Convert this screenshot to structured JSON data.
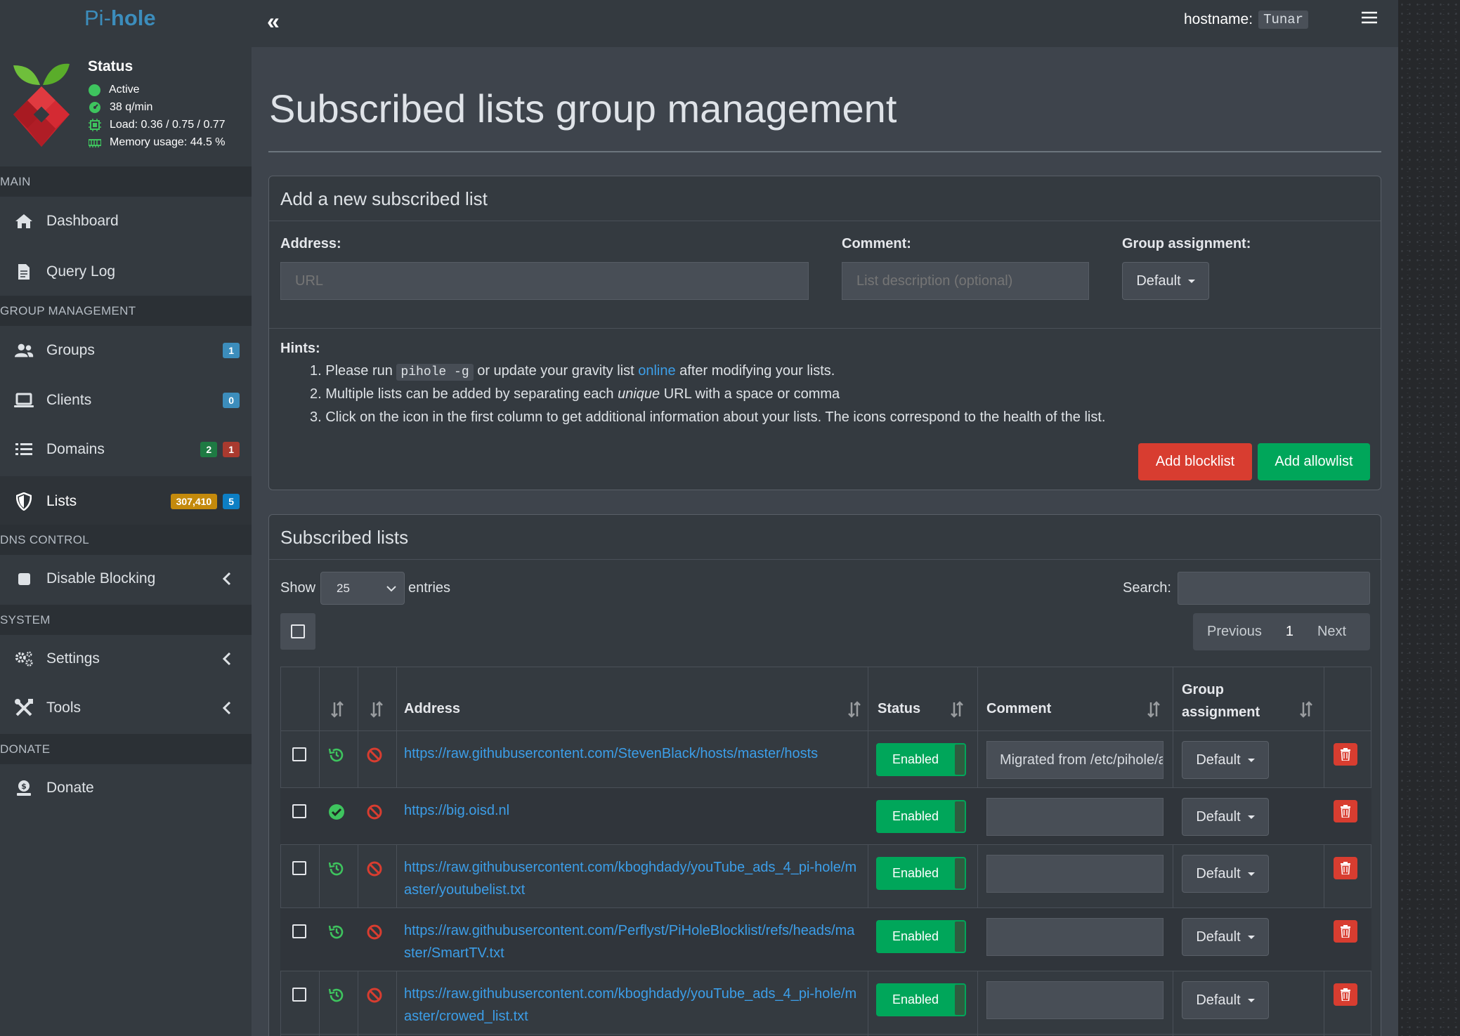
{
  "brand": {
    "prefix": "Pi-",
    "name": "hole"
  },
  "status": {
    "title": "Status",
    "active": "Active",
    "queries": "38 q/min",
    "load": "Load: 0.36 / 0.75 / 0.77",
    "memory": "Memory usage: 44.5 %"
  },
  "topbar": {
    "collapse": "«",
    "hostname_label": "hostname:",
    "hostname": "Tunar"
  },
  "sidebar": {
    "sections": {
      "main": "MAIN",
      "group": "GROUP MANAGEMENT",
      "dns": "DNS CONTROL",
      "system": "SYSTEM",
      "donate": "DONATE"
    },
    "items": {
      "dashboard": "Dashboard",
      "querylog": "Query Log",
      "groups": "Groups",
      "clients": "Clients",
      "domains": "Domains",
      "lists": "Lists",
      "disable": "Disable Blocking",
      "settings": "Settings",
      "tools": "Tools",
      "donate": "Donate"
    },
    "badges": {
      "groups": "1",
      "clients": "0",
      "domains_allow": "2",
      "domains_deny": "1",
      "lists_domains": "307,410",
      "lists_count": "5"
    }
  },
  "page": {
    "title": "Subscribed lists group management"
  },
  "addbox": {
    "title": "Add a new subscribed list",
    "address_label": "Address:",
    "address_placeholder": "URL",
    "comment_label": "Comment:",
    "comment_placeholder": "List description (optional)",
    "group_label": "Group assignment:",
    "group_value": "Default",
    "hints_title": "Hints:",
    "hint1_a": "1. Please run",
    "hint1_code": "pihole -g",
    "hint1_b": "or update your gravity list",
    "hint1_link": "online",
    "hint1_c": "after modifying your lists.",
    "hint2_a": "2. Multiple lists can be added by separating each",
    "hint2_em": "unique",
    "hint2_b": "URL with a space or comma",
    "hint3": "3. Click on the icon in the first column to get additional information about your lists. The icons correspond to the health of the list.",
    "add_blocklist": "Add blocklist",
    "add_allowlist": "Add allowlist"
  },
  "listbox": {
    "title": "Subscribed lists",
    "show": "Show",
    "entries_value": "25",
    "entries": "entries",
    "search_label": "Search:",
    "pager": {
      "prev": "Previous",
      "page": "1",
      "next": "Next"
    },
    "columns": {
      "address": "Address",
      "status": "Status",
      "comment": "Comment",
      "group1": "Group",
      "group2": "assignment"
    },
    "rows": [
      {
        "address": "https://raw.githubusercontent.com/StevenBlack/hosts/master/hosts",
        "status": "Enabled",
        "comment": "Migrated from /etc/pihole/adlists.list",
        "group": "Default",
        "health": "history"
      },
      {
        "address": "https://big.oisd.nl",
        "status": "Enabled",
        "comment": "",
        "group": "Default",
        "health": "ok"
      },
      {
        "address": "https://raw.githubusercontent.com/kboghdady/youTube_ads_4_pi-hole/master/youtubelist.txt",
        "status": "Enabled",
        "comment": "",
        "group": "Default",
        "health": "history"
      },
      {
        "address": "https://raw.githubusercontent.com/Perflyst/PiHoleBlocklist/refs/heads/master/SmartTV.txt",
        "status": "Enabled",
        "comment": "",
        "group": "Default",
        "health": "history"
      },
      {
        "address": "https://raw.githubusercontent.com/kboghdady/youTube_ads_4_pi-hole/master/crowed_list.txt",
        "status": "Enabled",
        "comment": "",
        "group": "Default",
        "health": "history"
      }
    ]
  },
  "colors": {
    "accent": "#3c8dbc",
    "enabled": "#00a65a",
    "danger": "#d83d30",
    "link": "#3c9ee8"
  }
}
